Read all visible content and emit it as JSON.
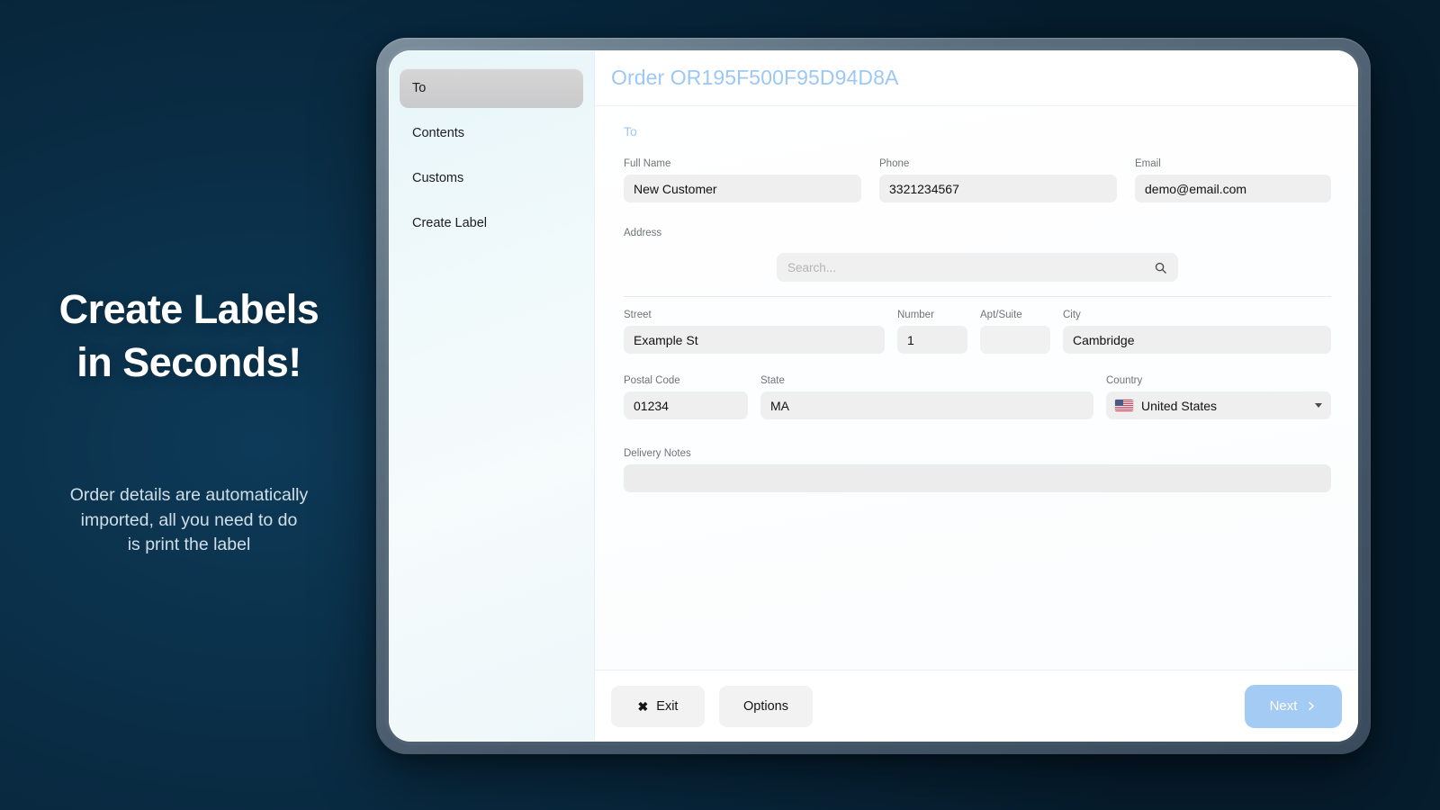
{
  "promo": {
    "headline_line1": "Create Labels",
    "headline_line2": "in Seconds!",
    "subtext_line1": "Order details are automatically",
    "subtext_line2": "imported, all you need to do",
    "subtext_line3": "is print the label"
  },
  "colors": {
    "background_dark": "#0a2d45",
    "device_bezel": "#5d707f",
    "accent_blue": "#9cc8f5",
    "next_button": "#a4cbf4",
    "sidebar_bg": "#eff9fb",
    "input_bg": "#efefef",
    "nav_active_bg": "#cfcfd0"
  },
  "sidebar": {
    "items": [
      {
        "label": "To",
        "active": true
      },
      {
        "label": "Contents",
        "active": false
      },
      {
        "label": "Customs",
        "active": false
      },
      {
        "label": "Create Label",
        "active": false
      }
    ]
  },
  "header": {
    "order_title": "Order OR195F500F95D94D8A"
  },
  "form": {
    "section_label": "To",
    "full_name": {
      "label": "Full Name",
      "value": "New Customer"
    },
    "phone": {
      "label": "Phone",
      "value": "3321234567"
    },
    "email": {
      "label": "Email",
      "value": "demo@email.com"
    },
    "address": {
      "label": "Address",
      "search_placeholder": "Search...",
      "search_value": "",
      "search_icon": "search-icon"
    },
    "street": {
      "label": "Street",
      "value": "Example St"
    },
    "number": {
      "label": "Number",
      "value": "1"
    },
    "apt_suite": {
      "label": "Apt/Suite",
      "value": ""
    },
    "city": {
      "label": "City",
      "value": "Cambridge"
    },
    "postal_code": {
      "label": "Postal Code",
      "value": "01234"
    },
    "state": {
      "label": "State",
      "value": "MA"
    },
    "country": {
      "label": "Country",
      "value": "United States",
      "flag_icon": "us-flag-icon",
      "caret_icon": "chevron-down-icon"
    },
    "delivery_notes": {
      "label": "Delivery Notes",
      "value": ""
    }
  },
  "footer": {
    "exit_label": "Exit",
    "exit_icon": "close-x-icon",
    "options_label": "Options",
    "next_label": "Next",
    "next_icon": "chevron-right-icon"
  }
}
